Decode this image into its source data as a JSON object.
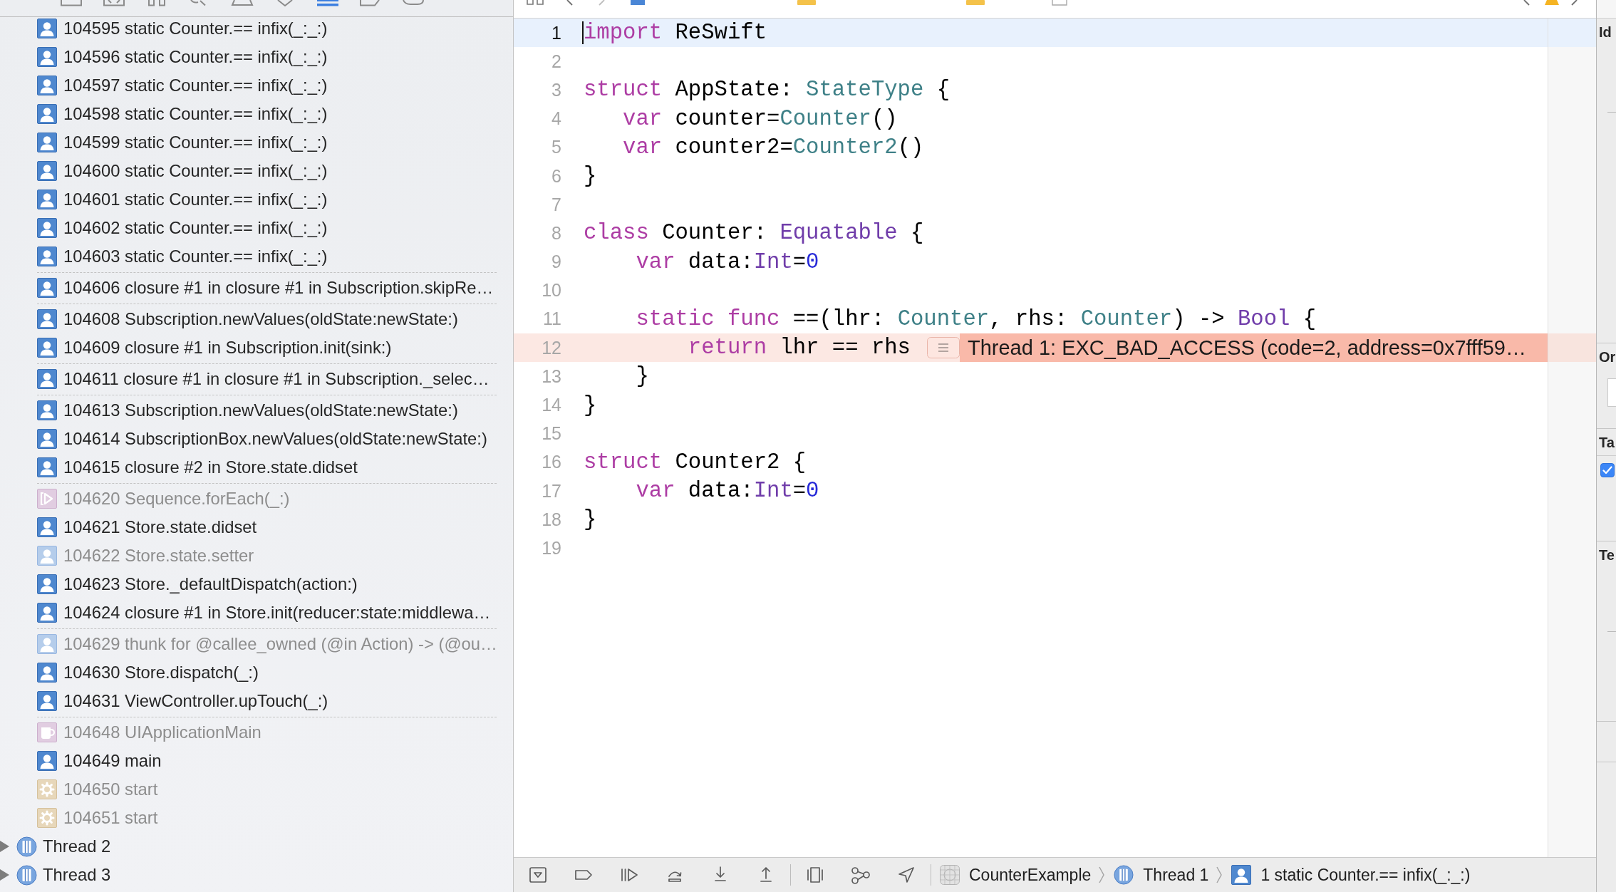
{
  "navigator": {
    "tabs": [
      {
        "kind": "folder",
        "selected": false
      },
      {
        "kind": "source-control",
        "selected": false
      },
      {
        "kind": "symbols",
        "selected": false
      },
      {
        "kind": "find",
        "selected": false
      },
      {
        "kind": "issues",
        "selected": false
      },
      {
        "kind": "tests",
        "selected": false
      },
      {
        "kind": "debug",
        "selected": true
      },
      {
        "kind": "breakpoints",
        "selected": false
      },
      {
        "kind": "reports",
        "selected": false
      }
    ]
  },
  "debug_navigator": {
    "frame_groups": [
      [
        {
          "label": "104595 static Counter.== infix(_:_:)",
          "kind": "user",
          "dimmed": false
        },
        {
          "label": "104596 static Counter.== infix(_:_:)",
          "kind": "user",
          "dimmed": false
        },
        {
          "label": "104597 static Counter.== infix(_:_:)",
          "kind": "user",
          "dimmed": false
        },
        {
          "label": "104598 static Counter.== infix(_:_:)",
          "kind": "user",
          "dimmed": false
        },
        {
          "label": "104599 static Counter.== infix(_:_:)",
          "kind": "user",
          "dimmed": false
        },
        {
          "label": "104600 static Counter.== infix(_:_:)",
          "kind": "user",
          "dimmed": false
        },
        {
          "label": "104601 static Counter.== infix(_:_:)",
          "kind": "user",
          "dimmed": false
        },
        {
          "label": "104602 static Counter.== infix(_:_:)",
          "kind": "user",
          "dimmed": false
        },
        {
          "label": "104603 static Counter.== infix(_:_:)",
          "kind": "user",
          "dimmed": false
        }
      ],
      [
        {
          "label": "104606 closure #1 in closure #1 in Subscription.skipRe…",
          "kind": "user",
          "dimmed": false
        }
      ],
      [
        {
          "label": "104608 Subscription.newValues(oldState:newState:)",
          "kind": "user",
          "dimmed": false
        },
        {
          "label": "104609 closure #1 in Subscription.init(sink:)",
          "kind": "user",
          "dimmed": false
        }
      ],
      [
        {
          "label": "104611 closure #1 in closure #1 in Subscription._selec…",
          "kind": "user",
          "dimmed": false
        }
      ],
      [
        {
          "label": "104613 Subscription.newValues(oldState:newState:)",
          "kind": "user",
          "dimmed": false
        },
        {
          "label": "104614 SubscriptionBox.newValues(oldState:newState:)",
          "kind": "user",
          "dimmed": false
        },
        {
          "label": "104615 closure #2 in Store.state.didset",
          "kind": "user",
          "dimmed": false
        }
      ],
      [
        {
          "label": "104620 Sequence.forEach(_:)",
          "kind": "library",
          "dimmed": true
        },
        {
          "label": "104621 Store.state.didset",
          "kind": "user",
          "dimmed": false
        },
        {
          "label": "104622 Store.state.setter",
          "kind": "user",
          "dimmed": true
        },
        {
          "label": "104623 Store._defaultDispatch(action:)",
          "kind": "user",
          "dimmed": false
        },
        {
          "label": "104624 closure #1 in Store.init(reducer:state:middlewa…",
          "kind": "user",
          "dimmed": false
        }
      ],
      [
        {
          "label": "104629 thunk for @callee_owned (@in Action) -> (@ou…",
          "kind": "user",
          "dimmed": true
        },
        {
          "label": "104630 Store.dispatch(_:)",
          "kind": "user",
          "dimmed": false
        },
        {
          "label": "104631 ViewController.upTouch(_:)",
          "kind": "user",
          "dimmed": false
        }
      ],
      [
        {
          "label": "104648 UIApplicationMain",
          "kind": "framework",
          "dimmed": true
        },
        {
          "label": "104649 main",
          "kind": "user",
          "dimmed": false
        },
        {
          "label": "104650 start",
          "kind": "system",
          "dimmed": true
        },
        {
          "label": "104651 start",
          "kind": "system",
          "dimmed": true
        }
      ]
    ],
    "threads": [
      {
        "label": "Thread 2",
        "expanded": false
      },
      {
        "label": "Thread 3",
        "expanded": false
      }
    ]
  },
  "editor": {
    "lines": [
      {
        "number": "1",
        "selected": true,
        "tokens": [
          {
            "kind": "keyword",
            "text": "import"
          },
          {
            "kind": "plain",
            "text": " ReSwift"
          }
        ]
      },
      {
        "number": "2",
        "selected": false
      },
      {
        "number": "3",
        "selected": false,
        "tokens": [
          {
            "kind": "keyword",
            "text": "struct"
          },
          {
            "kind": "plain",
            "text": " AppState: "
          },
          {
            "kind": "type",
            "text": "StateType"
          },
          {
            "kind": "plain",
            "text": " {"
          }
        ]
      },
      {
        "number": "4",
        "selected": false,
        "tokens": [
          {
            "kind": "keyword",
            "text": "   var"
          },
          {
            "kind": "plain",
            "text": " counter="
          },
          {
            "kind": "type",
            "text": "Counter"
          },
          {
            "kind": "plain",
            "text": "()"
          }
        ]
      },
      {
        "number": "5",
        "selected": false,
        "tokens": [
          {
            "kind": "keyword",
            "text": "   var"
          },
          {
            "kind": "plain",
            "text": " counter2="
          },
          {
            "kind": "type",
            "text": "Counter2"
          },
          {
            "kind": "plain",
            "text": "()"
          }
        ]
      },
      {
        "number": "6",
        "selected": false,
        "tokens": [
          {
            "kind": "plain",
            "text": "}"
          }
        ]
      },
      {
        "number": "7",
        "selected": false
      },
      {
        "number": "8",
        "selected": false,
        "tokens": [
          {
            "kind": "keyword",
            "text": "class"
          },
          {
            "kind": "plain",
            "text": " Counter: "
          },
          {
            "kind": "system_type",
            "text": "Equatable"
          },
          {
            "kind": "plain",
            "text": " {"
          }
        ]
      },
      {
        "number": "9",
        "selected": false,
        "tokens": [
          {
            "kind": "keyword",
            "text": "    var"
          },
          {
            "kind": "plain",
            "text": " data:"
          },
          {
            "kind": "system_type",
            "text": "Int"
          },
          {
            "kind": "plain",
            "text": "="
          },
          {
            "kind": "number",
            "text": "0"
          }
        ]
      },
      {
        "number": "10",
        "selected": false
      },
      {
        "number": "11",
        "selected": false,
        "tokens": [
          {
            "kind": "keyword",
            "text": "    static func"
          },
          {
            "kind": "plain",
            "text": " ==(lhr: "
          },
          {
            "kind": "type",
            "text": "Counter"
          },
          {
            "kind": "plain",
            "text": ", rhs: "
          },
          {
            "kind": "type",
            "text": "Counter"
          },
          {
            "kind": "plain",
            "text": ") -> "
          },
          {
            "kind": "system_type",
            "text": "Bool"
          },
          {
            "kind": "plain",
            "text": " {"
          }
        ]
      },
      {
        "number": "12",
        "selected": false,
        "tokens": [
          {
            "kind": "keyword",
            "text": "        return"
          },
          {
            "kind": "plain",
            "text": " lhr == rhs"
          }
        ],
        "error": "Thread 1: EXC_BAD_ACCESS (code=2, address=0x7fff59…"
      },
      {
        "number": "13",
        "selected": false,
        "tokens": [
          {
            "kind": "plain",
            "text": "    }"
          }
        ]
      },
      {
        "number": "14",
        "selected": false,
        "tokens": [
          {
            "kind": "plain",
            "text": "}"
          }
        ]
      },
      {
        "number": "15",
        "selected": false
      },
      {
        "number": "16",
        "selected": false,
        "tokens": [
          {
            "kind": "keyword",
            "text": "struct"
          },
          {
            "kind": "plain",
            "text": " Counter2 {"
          }
        ]
      },
      {
        "number": "17",
        "selected": false,
        "tokens": [
          {
            "kind": "keyword",
            "text": "    var"
          },
          {
            "kind": "plain",
            "text": " data:"
          },
          {
            "kind": "system_type",
            "text": "Int"
          },
          {
            "kind": "plain",
            "text": "="
          },
          {
            "kind": "number",
            "text": "0"
          }
        ]
      },
      {
        "number": "18",
        "selected": false,
        "tokens": [
          {
            "kind": "plain",
            "text": "}"
          }
        ]
      },
      {
        "number": "19",
        "selected": false
      }
    ]
  },
  "debug_bar": {
    "path": [
      {
        "kind": "app",
        "label": "CounterExample"
      },
      {
        "kind": "thread",
        "label": "Thread 1"
      },
      {
        "kind": "user",
        "label": "1 static Counter.== infix(_:_:)"
      }
    ]
  },
  "inspector": {
    "sections": [
      {
        "title": "Id",
        "kind": "plain"
      },
      {
        "title": "Or",
        "kind": "field"
      },
      {
        "title": "Ta",
        "kind": "checkbox",
        "checked": true
      },
      {
        "title": "Te",
        "kind": "plain"
      }
    ]
  }
}
